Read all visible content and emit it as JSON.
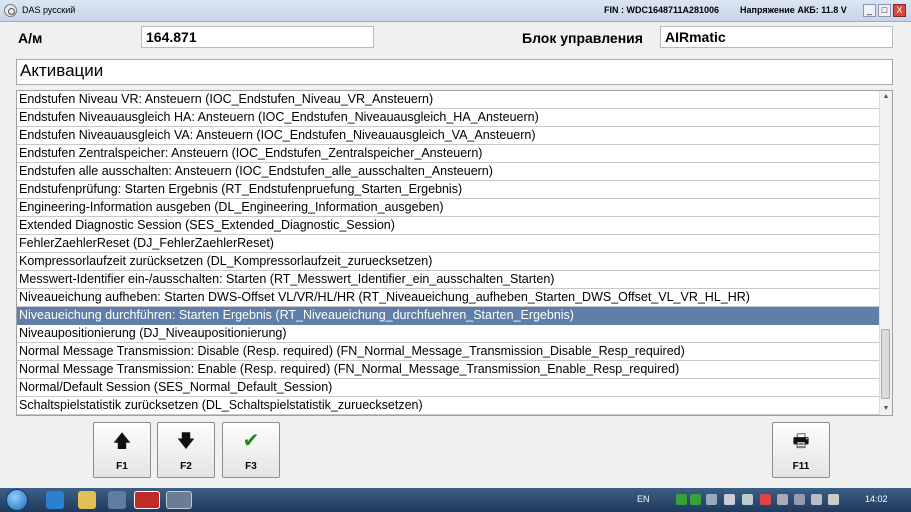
{
  "titlebar": {
    "app_title": "DAS русский",
    "fin": "FIN : WDC1648711A281006",
    "battery": "Напряжение АКБ: 11.8 V",
    "min_label": "_",
    "max_label": "□",
    "close_label": "X"
  },
  "header": {
    "am_label": "А/м",
    "am_value": "164.871",
    "ecu_label": "Блок управления",
    "ecu_value": "AIRmatic"
  },
  "section_title": "Активации",
  "list": {
    "selected_index": 13,
    "items": [
      "Endstufen Niveau VR: Ansteuern (IOC_Endstufen_Niveau_VR_Ansteuern)",
      "Endstufen Niveauausgleich HA: Ansteuern (IOC_Endstufen_Niveauausgleich_HA_Ansteuern)",
      "Endstufen Niveauausgleich VA: Ansteuern (IOC_Endstufen_Niveauausgleich_VA_Ansteuern)",
      "Endstufen Zentralspeicher: Ansteuern (IOC_Endstufen_Zentralspeicher_Ansteuern)",
      "Endstufen alle ausschalten: Ansteuern (IOC_Endstufen_alle_ausschalten_Ansteuern)",
      "Endstufenprüfung: Starten Ergebnis (RT_Endstufenpruefung_Starten_Ergebnis)",
      "Engineering-Information ausgeben (DL_Engineering_Information_ausgeben)",
      "Extended Diagnostic Session (SES_Extended_Diagnostic_Session)",
      "FehlerZaehlerReset (DJ_FehlerZaehlerReset)",
      "Kompressorlaufzeit zurücksetzen (DL_Kompressorlaufzeit_zuruecksetzen)",
      "Messwert-Identifier ein-/ausschalten: Starten (RT_Messwert_Identifier_ein_ausschalten_Starten)",
      "Niveaueichung aufheben: Starten DWS-Offset VL/VR/HL/HR (RT_Niveaueichung_aufheben_Starten_DWS_Offset_VL_VR_HL_HR)",
      "Niveaueichung durchführen: Starten Ergebnis (RT_Niveaueichung_durchfuehren_Starten_Ergebnis)",
      "Niveaupositionierung (DJ_Niveaupositionierung)",
      "Normal Message Transmission: Disable (Resp. required) (FN_Normal_Message_Transmission_Disable_Resp_required)",
      "Normal Message Transmission: Enable (Resp. required) (FN_Normal_Message_Transmission_Enable_Resp_required)",
      "Normal/Default Session (SES_Normal_Default_Session)",
      "Schaltspielstatistik zurücksetzen (DL_Schaltspielstatistik_zuruecksetzen)"
    ]
  },
  "buttons": {
    "f1": {
      "label": "F1",
      "icon": "arrow-up-icon",
      "glyph": "🡅"
    },
    "f2": {
      "label": "F2",
      "icon": "arrow-down-icon",
      "glyph": "🡇"
    },
    "f3": {
      "label": "F3",
      "icon": "checkmark-icon",
      "glyph": "✔"
    },
    "f11": {
      "label": "F11",
      "icon": "printer-icon",
      "glyph": "🖶"
    }
  },
  "taskbar": {
    "lang": "EN",
    "clock": "14:02"
  },
  "colors": {
    "selected_row": "#5f7ea8",
    "checkmark": "#1e8a1e"
  }
}
